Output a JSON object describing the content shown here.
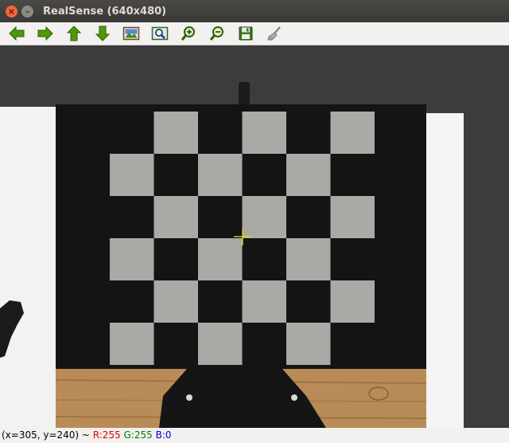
{
  "window": {
    "title": "RealSense (640x480)",
    "close_glyph": "×",
    "minimize_glyph": "–"
  },
  "toolbar": {
    "buttons": [
      {
        "name": "pan-left-button",
        "icon": "arrow-left-icon"
      },
      {
        "name": "pan-right-button",
        "icon": "arrow-right-icon"
      },
      {
        "name": "pan-up-button",
        "icon": "arrow-up-icon"
      },
      {
        "name": "pan-down-button",
        "icon": "arrow-down-icon"
      },
      {
        "name": "zoom-fit-button",
        "icon": "image-icon"
      },
      {
        "name": "zoom-original-button",
        "icon": "zoom-region-icon"
      },
      {
        "name": "zoom-in-button",
        "icon": "zoom-in-icon"
      },
      {
        "name": "zoom-out-button",
        "icon": "zoom-out-icon"
      },
      {
        "name": "save-button",
        "icon": "floppy-disk-icon"
      },
      {
        "name": "properties-button",
        "icon": "brush-icon"
      }
    ]
  },
  "colors": {
    "arrow_green": "#4e9a06",
    "crosshair": "#e6e600",
    "board_black": "#141414",
    "board_gray": "#a9aaa6"
  },
  "status": {
    "coords": "(x=305, y=240) ~ ",
    "r": "R:255",
    "g": "G:255",
    "b": "B:0"
  }
}
